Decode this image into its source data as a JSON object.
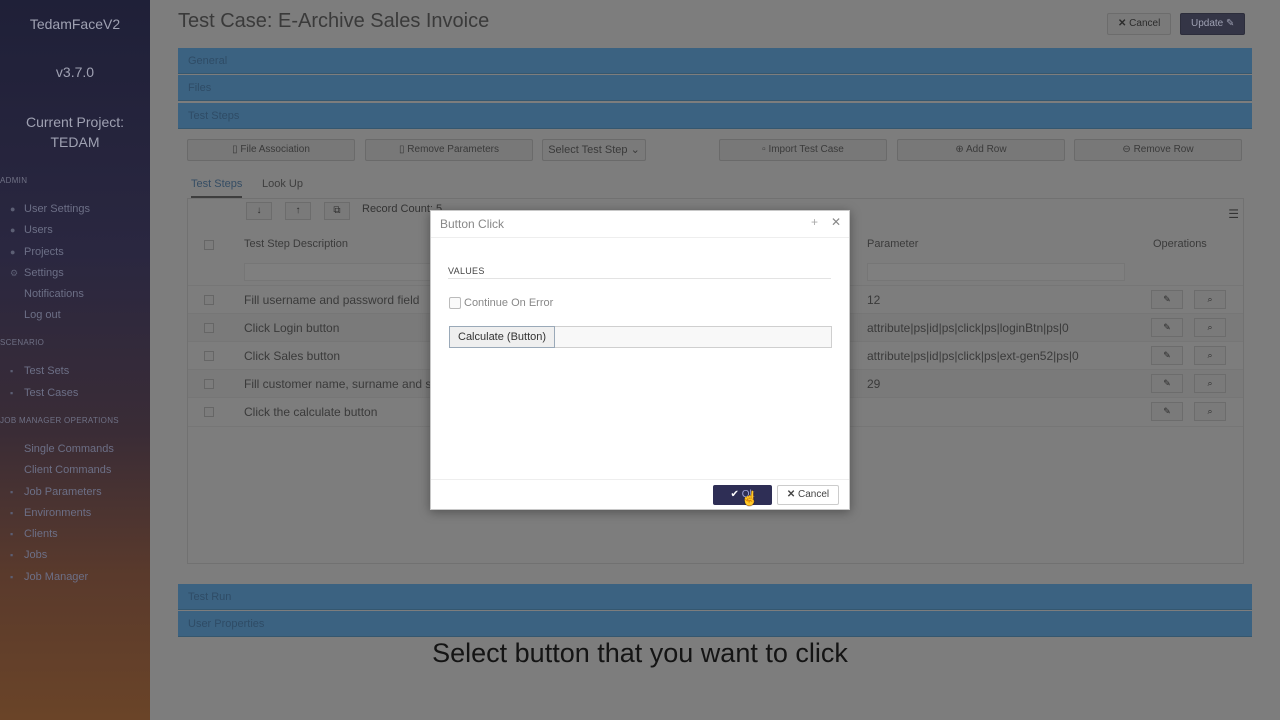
{
  "sidebar": {
    "brand": "TedamFaceV2",
    "version": "v3.7.0",
    "project_label": "Current Project:",
    "project_name": "TEDAM",
    "sections": {
      "admin": "ADMIN",
      "scenario": "SCENARIO",
      "job_ops": "JOB MANAGER OPERATIONS"
    },
    "admin_items": [
      "User Settings",
      "Users",
      "Projects",
      "Settings",
      "Notifications",
      "Log out"
    ],
    "scenario_items": [
      "Test Sets",
      "Test Cases"
    ],
    "job_items": [
      "Single Commands",
      "Client Commands",
      "Job Parameters",
      "Environments",
      "Clients",
      "Jobs",
      "Job Manager"
    ]
  },
  "header": {
    "title": "Test Case: E-Archive Sales Invoice",
    "cancel_label": "Cancel",
    "update_label": "Update"
  },
  "panels": {
    "general": "General",
    "files": "Files",
    "test_steps": "Test Steps",
    "test_run": "Test Run",
    "user_properties": "User Properties"
  },
  "toolbar": {
    "file_association": "File Association",
    "remove_parameters": "Remove Parameters",
    "select_test_step": "Select Test Step",
    "import_test_case": "Import Test Case",
    "add_row": "Add Row",
    "remove_row": "Remove Row"
  },
  "tabs": [
    "Test Steps",
    "Look Up"
  ],
  "grid": {
    "record_count": "Record Count: 5",
    "columns": {
      "description": "Test Step Description",
      "parameter": "Parameter",
      "operations": "Operations"
    },
    "rows": [
      {
        "description": "Fill username and password field",
        "parameter": "12"
      },
      {
        "description": "Click Login button",
        "parameter": "attribute|ps|id|ps|click|ps|loginBtn|ps|0"
      },
      {
        "description": "Click Sales button",
        "parameter": "attribute|ps|id|ps|click|ps|ext-gen52|ps|0"
      },
      {
        "description": "Fill customer name, surname and s",
        "parameter": "29"
      },
      {
        "description": "Click the calculate button",
        "parameter": ""
      }
    ]
  },
  "modal": {
    "title": "Button Click",
    "values_label": "VALUES",
    "continue_on_error": "Continue On Error",
    "selected_value": "Calculate (Button)",
    "ok_label": "Ok",
    "cancel_label": "Cancel"
  },
  "caption": "Select button that you want to click"
}
